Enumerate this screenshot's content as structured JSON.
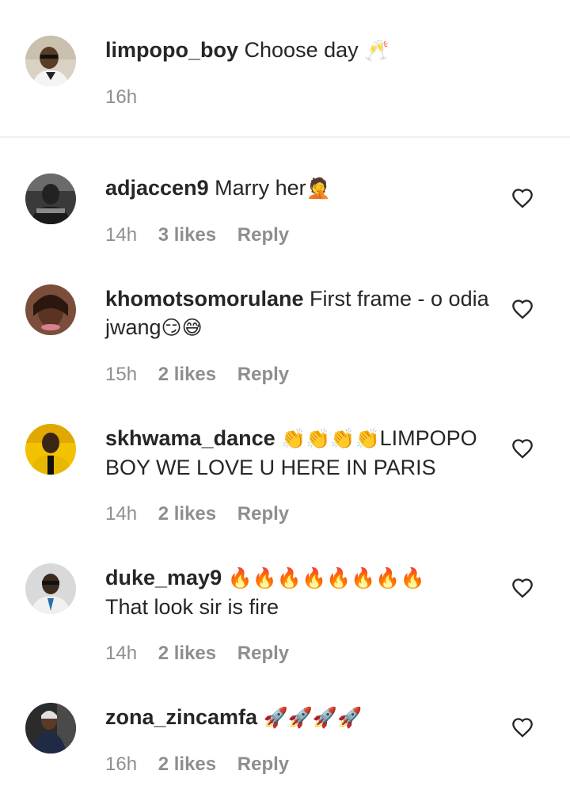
{
  "caption": {
    "username": "limpopo_boy",
    "text": "Choose day",
    "emoji": "🥂",
    "time": "16h"
  },
  "comments": [
    {
      "username": "adjaccen9",
      "text": "Marry her",
      "emoji": "🤦",
      "time": "14h",
      "likes": "3 likes",
      "reply": "Reply"
    },
    {
      "username": "khomotsomorulane",
      "text": "First frame - o odia jwang",
      "emoji": "😏😅",
      "time": "15h",
      "likes": "2 likes",
      "reply": "Reply"
    },
    {
      "username": "skhwama_dance",
      "emoji": "👏👏👏👏",
      "text": "LIMPOPO BOY WE LOVE U HERE IN PARIS",
      "time": "14h",
      "likes": "2 likes",
      "reply": "Reply"
    },
    {
      "username": "duke_may9",
      "emoji": "🔥🔥🔥🔥🔥🔥🔥🔥",
      "text": "That look sir is fire",
      "time": "14h",
      "likes": "2 likes",
      "reply": "Reply"
    },
    {
      "username": "zona_zincamfa",
      "emoji": "🚀🚀🚀🚀",
      "text": "",
      "time": "16h",
      "likes": "2 likes",
      "reply": "Reply"
    }
  ],
  "icons": {
    "heart": "heart-outline-icon"
  },
  "colors": {
    "text": "#262626",
    "secondary": "#8e8e8e",
    "divider": "#efefef"
  }
}
